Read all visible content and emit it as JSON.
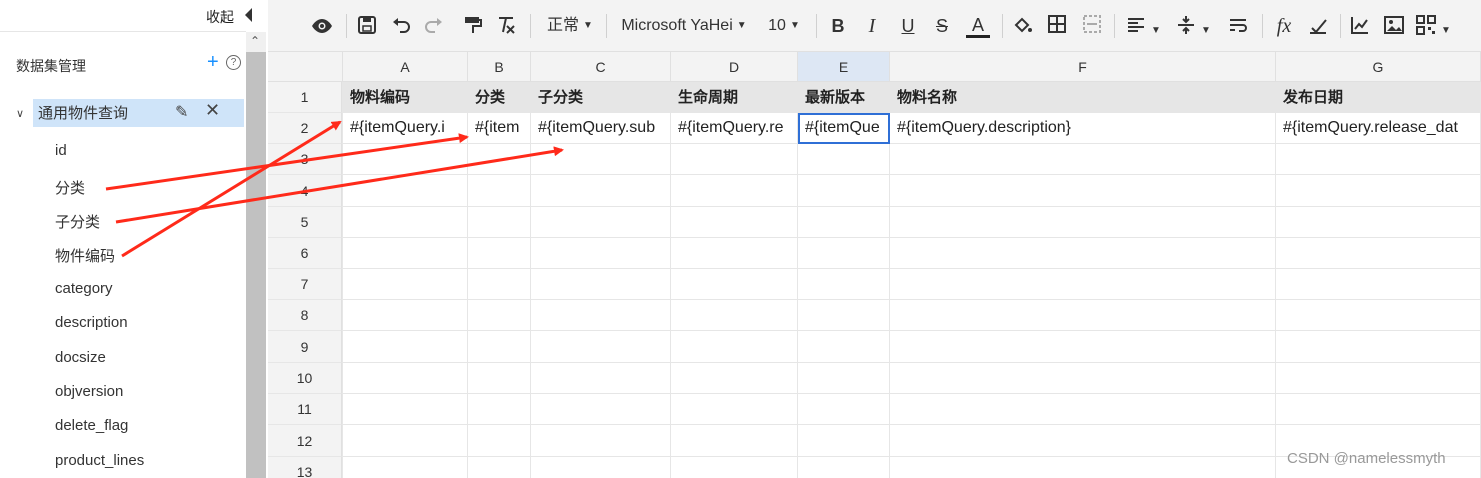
{
  "left_panel": {
    "collapse_label": "收起",
    "dataset_title": "数据集管理",
    "add_symbol": "+",
    "help_symbol": "?",
    "dataset_name": "通用物件查询",
    "fields": [
      "id",
      "分类",
      "子分类",
      "物件编码",
      "category",
      "description",
      "docsize",
      "objversion",
      "delete_flag",
      "product_lines"
    ]
  },
  "toolbar": {
    "paragraph_style": "正常",
    "font_family": "Microsoft YaHei",
    "font_size": "10",
    "bold": "B",
    "italic": "I",
    "underline": "U",
    "strike": "S",
    "font_color": "A",
    "formula": "fx"
  },
  "sheet": {
    "columns": [
      "A",
      "B",
      "C",
      "D",
      "E",
      "F",
      "G"
    ],
    "active_column": "E",
    "rows": [
      "1",
      "2",
      "3",
      "4",
      "5",
      "6",
      "7",
      "8",
      "9",
      "10",
      "11",
      "12",
      "13"
    ],
    "header_row": [
      "物料编码",
      "分类",
      "子分类",
      "生命周期",
      "最新版本",
      "物料名称",
      "发布日期"
    ],
    "data_row": [
      "#{itemQuery.i",
      "#{item",
      "#{itemQuery.sub",
      "#{itemQuery.re",
      "#{itemQue",
      "#{itemQuery.description}",
      "#{itemQuery.release_dat"
    ]
  },
  "watermark": "CSDN @namelessmyth"
}
